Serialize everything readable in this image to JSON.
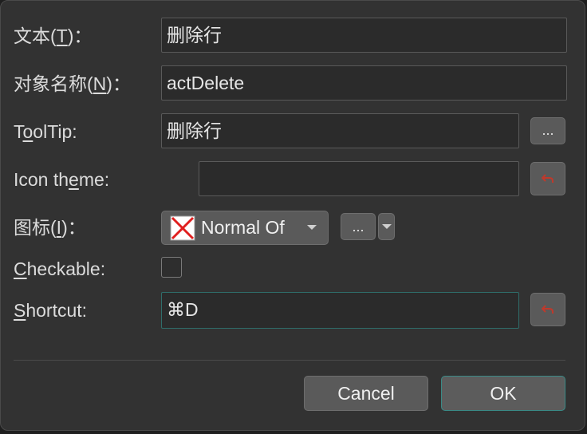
{
  "form": {
    "text": {
      "label_pre": "文本(",
      "label_mn": "T",
      "label_post": ")：",
      "value": "删除行"
    },
    "object_name": {
      "label_pre": "对象名称(",
      "label_mn": "N",
      "label_post": ")：",
      "value": "actDelete"
    },
    "tooltip": {
      "label_pre": "T",
      "label_mn": "o",
      "label_post": "olTip:",
      "value": "删除行",
      "browse_label": "..."
    },
    "icon_theme": {
      "label_pre": "Icon th",
      "label_mn": "e",
      "label_post": "me:",
      "value": ""
    },
    "icon": {
      "label_pre": "图标(",
      "label_mn": "I",
      "label_post": ")：",
      "mode_value": "Normal Of",
      "browse_label": "..."
    },
    "checkable": {
      "label_mn": "C",
      "label_post": "heckable:",
      "checked": false
    },
    "shortcut": {
      "label_mn": "S",
      "label_post": "hortcut:",
      "value": "⌘D"
    }
  },
  "buttons": {
    "cancel": "Cancel",
    "ok": "OK"
  },
  "icons": {
    "reset": "reset-arrow-icon",
    "broken_image": "broken-image-icon",
    "dropdown": "chevron-down-icon"
  },
  "colors": {
    "reset_icon": "#c0392b",
    "focus_border": "#2f6d6a",
    "broken_image": "#e01f1f"
  }
}
